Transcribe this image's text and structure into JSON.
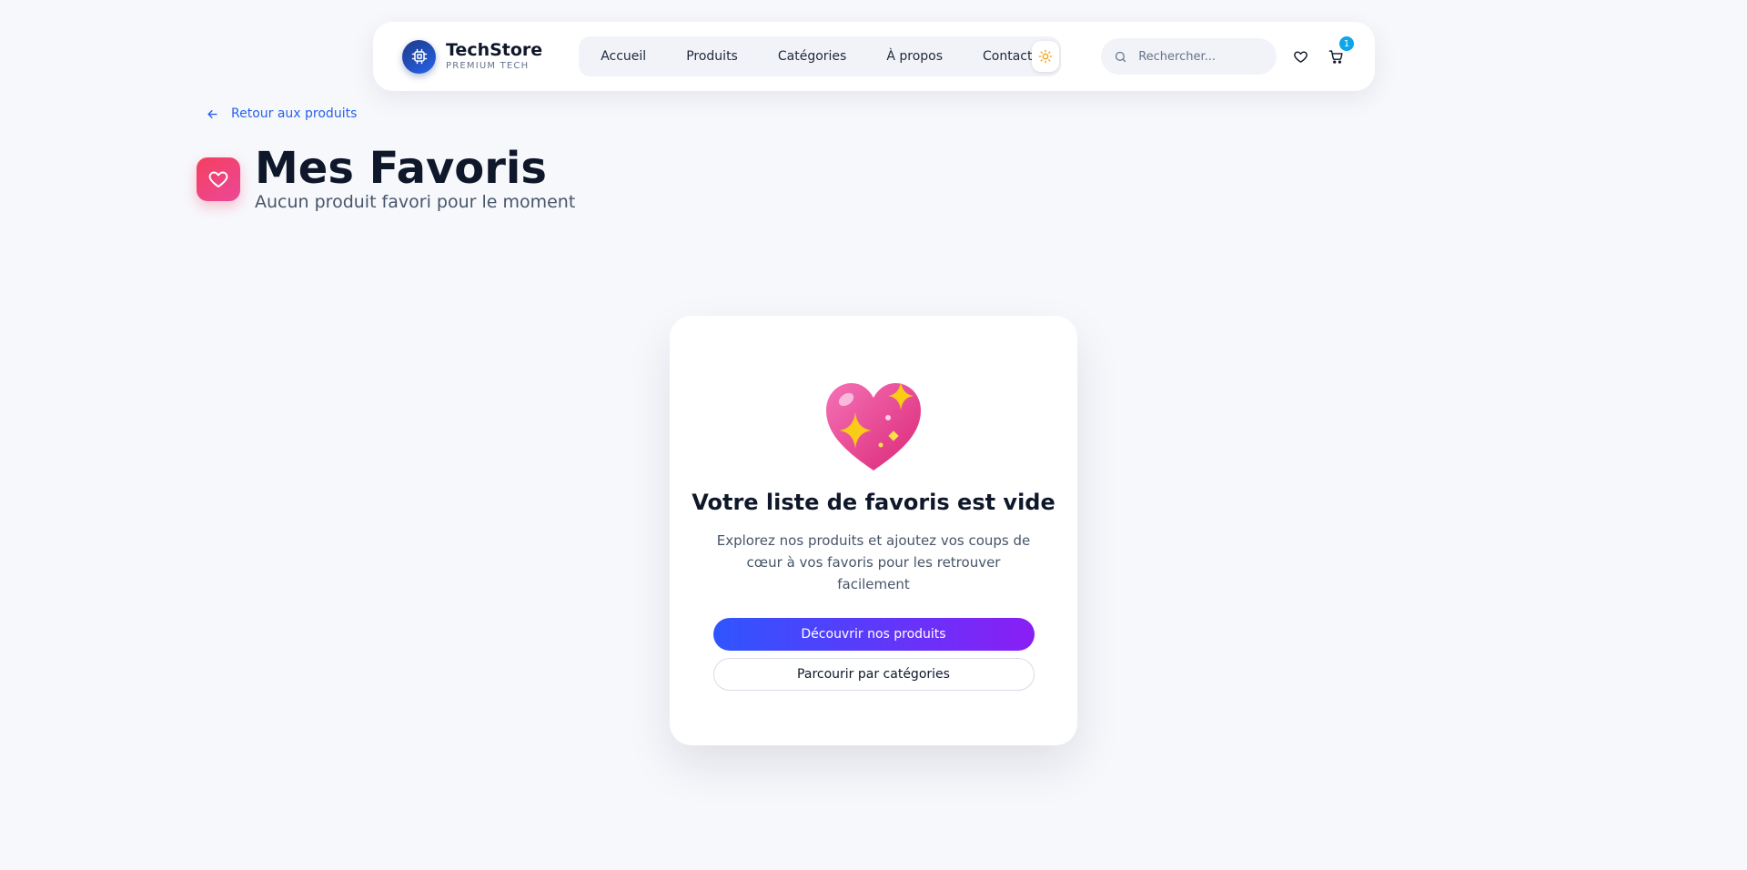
{
  "brand": {
    "name": "TechStore",
    "tagline": "PREMIUM TECH"
  },
  "nav": {
    "links": [
      "Accueil",
      "Produits",
      "Catégories",
      "À propos",
      "Contact"
    ],
    "theme_icon": "sun-icon"
  },
  "search": {
    "placeholder": "Rechercher..."
  },
  "cart": {
    "count": "1"
  },
  "back": {
    "label": "Retour aux produits"
  },
  "header": {
    "title": "Mes Favoris",
    "subtitle": "Aucun produit favori pour le moment",
    "icon": "heart-icon"
  },
  "empty_state": {
    "icon": "sparkling-heart-icon",
    "title": "Votre liste de favoris est vide",
    "description": "Explorez nos produits et ajoutez vos coups de cœur à vos favoris pour les retrouver facilement",
    "primary_button": "Découvrir nos produits",
    "secondary_button": "Parcourir par catégories"
  },
  "colors": {
    "accent": "#2563eb",
    "gradient_start": "#2f55ff",
    "gradient_end": "#8a1ef5",
    "heart": "#f43f5e",
    "badge": "#0ea5e9"
  }
}
